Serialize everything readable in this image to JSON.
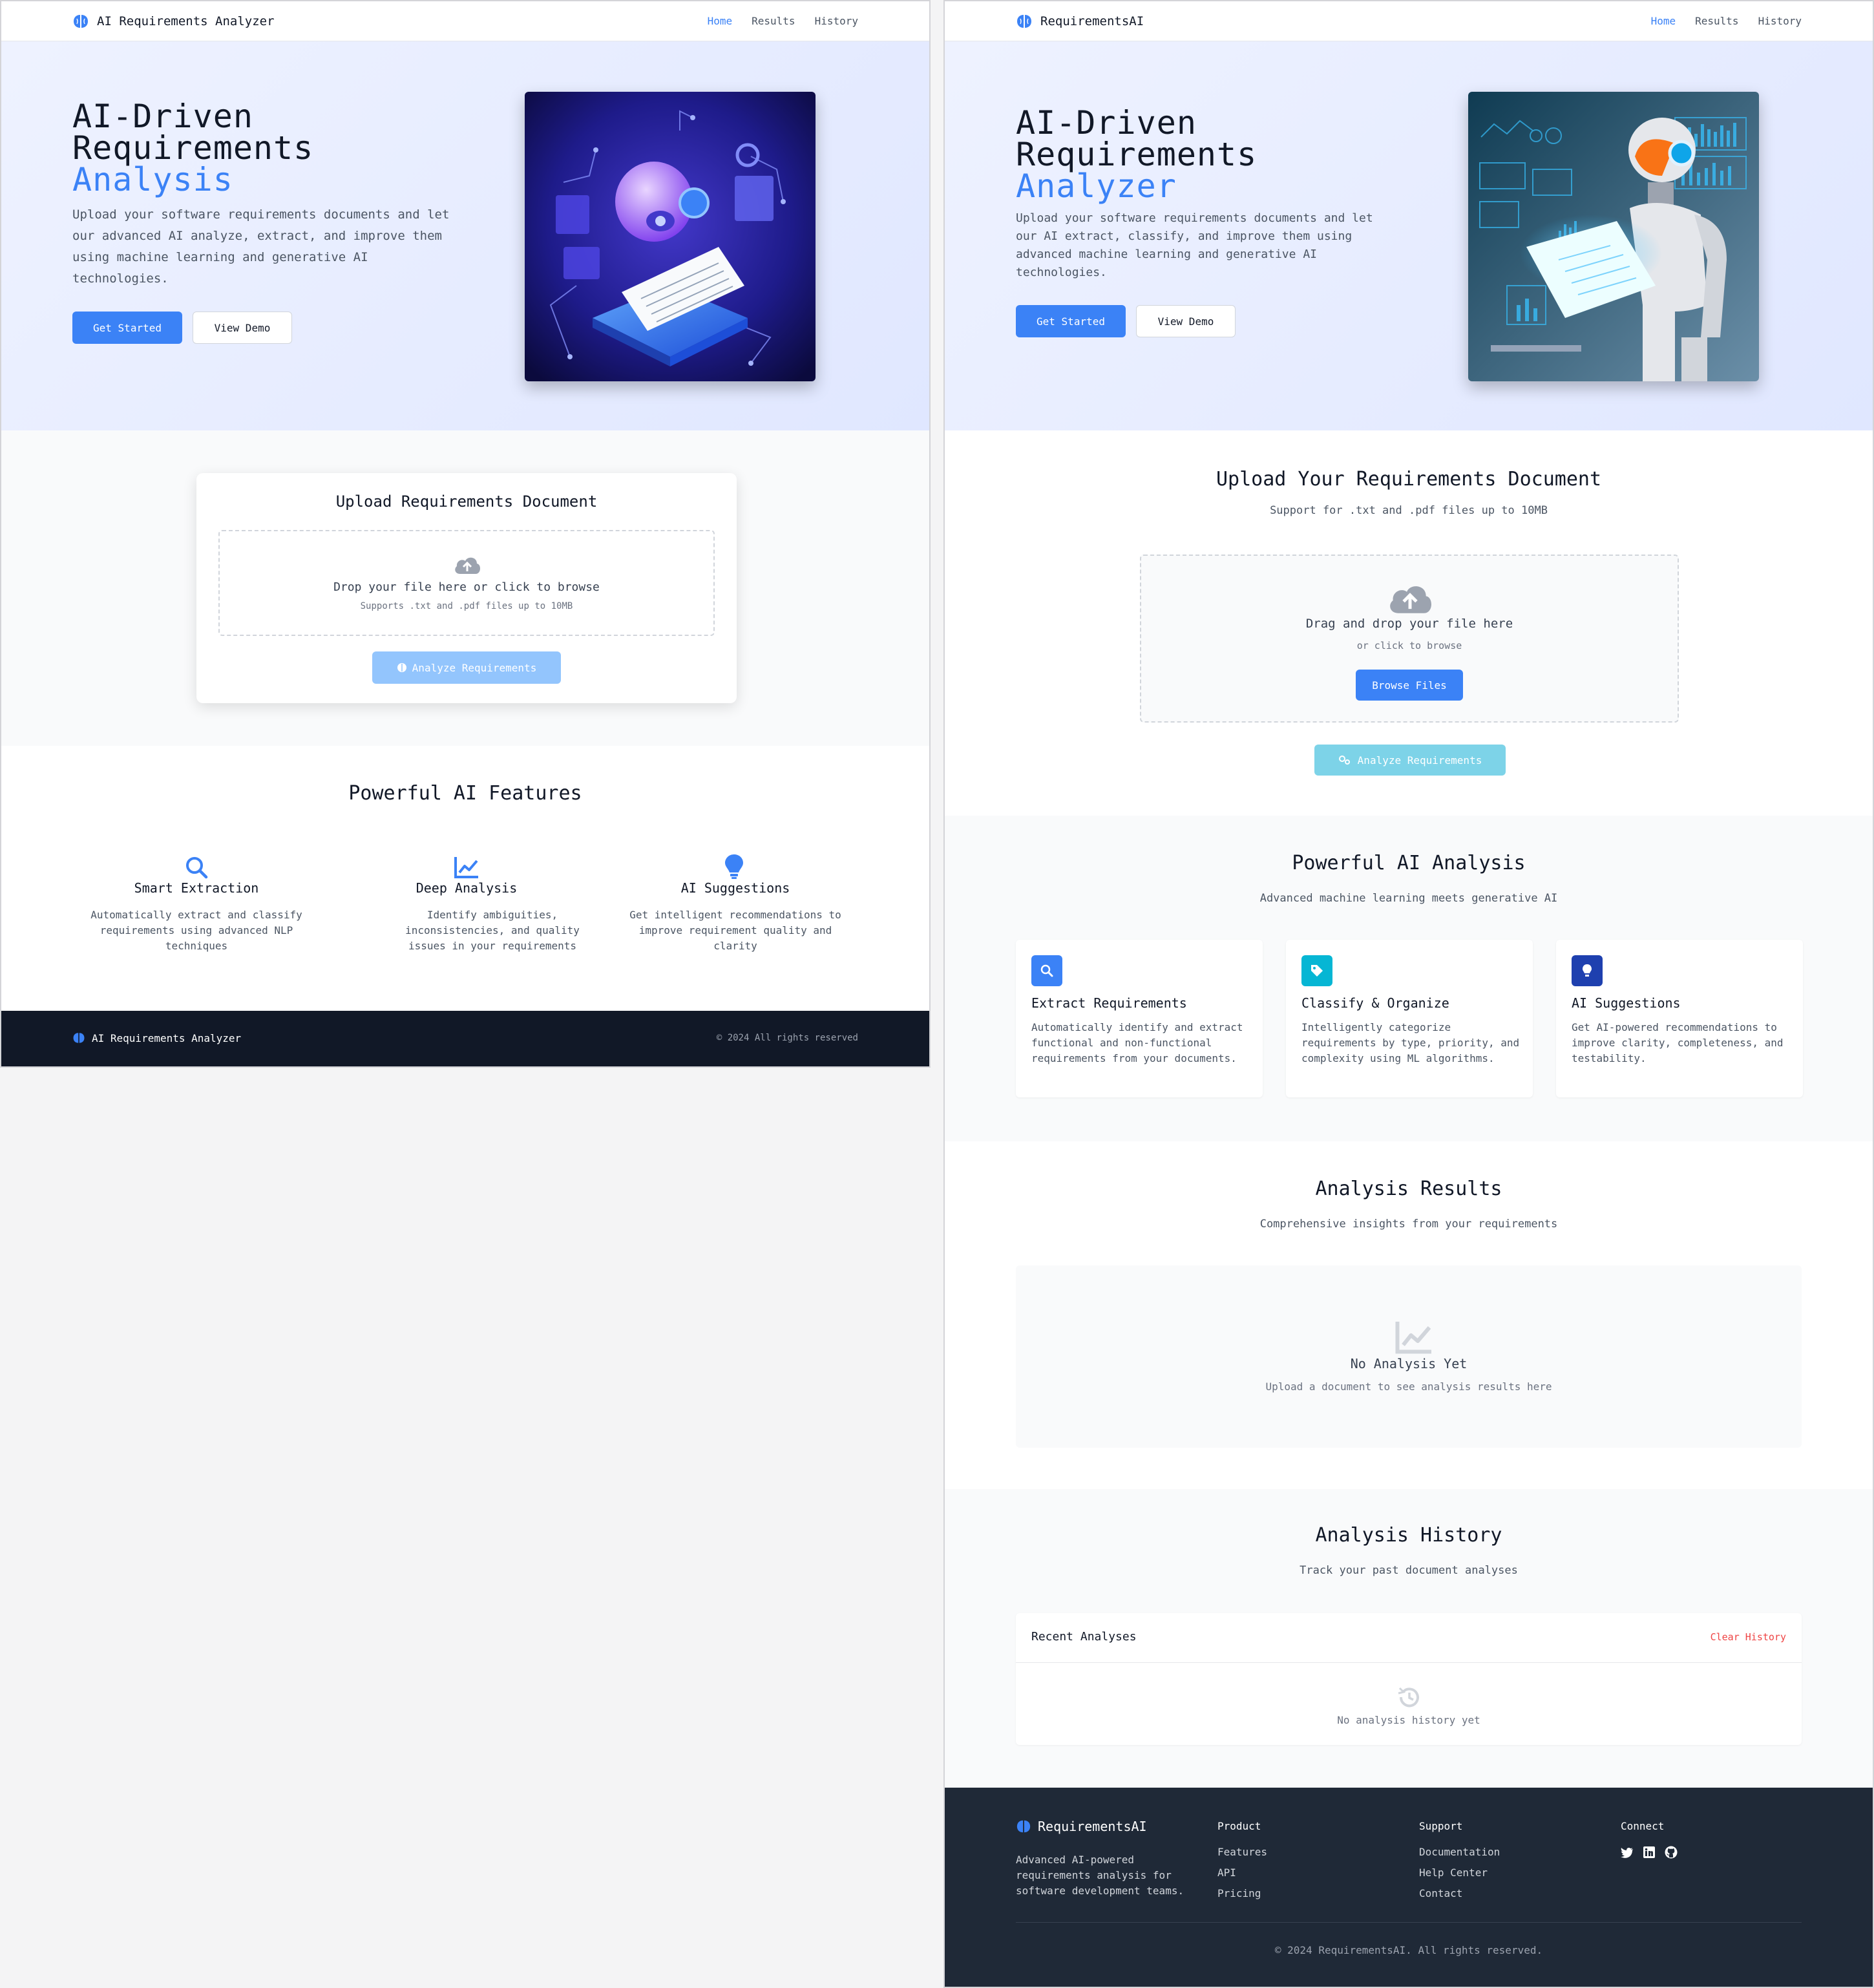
{
  "left": {
    "brand": "AI Requirements Analyzer",
    "nav": [
      "Home",
      "Results",
      "History"
    ],
    "hero": {
      "title_line1": "AI-Driven",
      "title_line2": "Requirements",
      "title_accent": "Analysis",
      "subtitle": "Upload your software requirements documents and let our advanced AI analyze, extract, and improve them using machine learning and generative AI technologies.",
      "primary_btn": "Get Started",
      "secondary_btn": "View Demo"
    },
    "upload": {
      "title": "Upload Requirements Document",
      "drop_text": "Drop your file here or click to browse",
      "drop_hint": "Supports .txt and .pdf files up to 10MB",
      "analyze_btn": "Analyze Requirements"
    },
    "features": {
      "title": "Powerful AI Features",
      "items": [
        {
          "icon": "search-icon",
          "title": "Smart Extraction",
          "desc": "Automatically extract and classify requirements using advanced NLP techniques"
        },
        {
          "icon": "chart-line-icon",
          "title": "Deep Analysis",
          "desc": "Identify ambiguities, inconsistencies, and quality issues in your requirements"
        },
        {
          "icon": "lightbulb-icon",
          "title": "AI Suggestions",
          "desc": "Get intelligent recommendations to improve requirement quality and clarity"
        }
      ]
    },
    "footer": {
      "brand": "AI Requirements Analyzer",
      "copyright": "© 2024 All rights reserved"
    }
  },
  "right": {
    "brand": "RequirementsAI",
    "nav": [
      "Home",
      "Results",
      "History"
    ],
    "hero": {
      "title_line1": "AI-Driven",
      "title_line2": "Requirements",
      "title_accent": "Analyzer",
      "subtitle": "Upload your software requirements documents and let our AI extract, classify, and improve them using advanced machine learning and generative AI technologies.",
      "primary_btn": "Get Started",
      "secondary_btn": "View Demo"
    },
    "upload": {
      "title": "Upload Your Requirements Document",
      "subtitle": "Support for .txt and .pdf files up to 10MB",
      "drop_text": "Drag and drop your file here",
      "drop_hint": "or click to browse",
      "browse_btn": "Browse Files",
      "analyze_btn": "Analyze Requirements"
    },
    "analysis": {
      "title": "Powerful AI Analysis",
      "subtitle": "Advanced machine learning meets generative AI",
      "cards": [
        {
          "icon": "search-icon",
          "color": "#3b82f6",
          "title": "Extract Requirements",
          "desc": "Automatically identify and extract functional and non-functional requirements from your documents."
        },
        {
          "icon": "tag-icon",
          "color": "#06b6d4",
          "title": "Classify & Organize",
          "desc": "Intelligently categorize requirements by type, priority, and complexity using ML algorithms."
        },
        {
          "icon": "lightbulb-icon",
          "color": "#1e40af",
          "title": "AI Suggestions",
          "desc": "Get AI-powered recommendations to improve clarity, completeness, and testability."
        }
      ]
    },
    "results": {
      "title": "Analysis Results",
      "subtitle": "Comprehensive insights from your requirements",
      "empty_title": "No Analysis Yet",
      "empty_desc": "Upload a document to see analysis results here"
    },
    "history": {
      "title": "Analysis History",
      "subtitle": "Track your past document analyses",
      "panel_title": "Recent Analyses",
      "clear_btn": "Clear History",
      "empty": "No analysis history yet"
    },
    "footer": {
      "brand": "RequirementsAI",
      "desc": "Advanced AI-powered requirements analysis for software development teams.",
      "product_h": "Product",
      "product_links": [
        "Features",
        "API",
        "Pricing"
      ],
      "support_h": "Support",
      "support_links": [
        "Documentation",
        "Help Center",
        "Contact"
      ],
      "connect_h": "Connect",
      "social_icons": [
        "twitter-icon",
        "linkedin-icon",
        "github-icon"
      ],
      "copyright": "© 2024 RequirementsAI. All rights reserved."
    }
  }
}
